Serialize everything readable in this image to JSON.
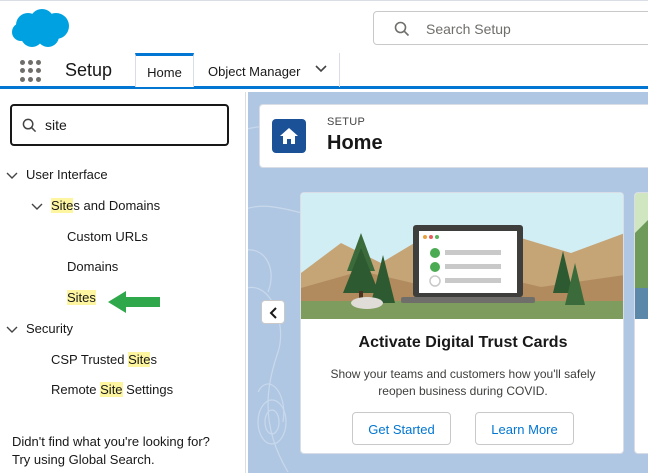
{
  "header": {
    "search_placeholder": "Search Setup"
  },
  "context_bar": {
    "app_name": "Setup",
    "tabs": [
      {
        "label": "Home",
        "active": true
      },
      {
        "label": "Object Manager",
        "active": false
      }
    ]
  },
  "sidebar": {
    "quick_find_value": "site",
    "tree": {
      "user_interface": "User Interface",
      "sites_and_domains_hl": "Site",
      "sites_and_domains_rest": "s and Domains",
      "custom_urls": "Custom URLs",
      "domains": "Domains",
      "sites": "Sites",
      "security": "Security",
      "csp_prefix": "CSP Trusted ",
      "csp_hl": "Site",
      "csp_suffix": "s",
      "remote_prefix": "Remote ",
      "remote_hl": "Site",
      "remote_suffix": " Settings"
    },
    "not_found_line1": "Didn't find what you're looking for?",
    "not_found_line2": "Try using Global Search."
  },
  "page_header": {
    "eyebrow": "SETUP",
    "title": "Home"
  },
  "card": {
    "title": "Activate Digital Trust Cards",
    "description": "Show your teams and customers how you'll safely reopen business during COVID.",
    "primary_button": "Get Started",
    "secondary_button": "Learn More"
  },
  "colors": {
    "brand_blue": "#0176d3",
    "logo_blue": "#00a1e0",
    "highlight": "#fdf5a0",
    "arrow_green": "#2ea84a",
    "home_icon_bg": "#1b5297",
    "main_bg": "#b0c7e3"
  },
  "icons": {
    "logo": "salesforce-cloud-logo",
    "search": "search-icon",
    "launcher": "app-launcher-icon",
    "home": "home-icon",
    "arrow": "green-left-arrow"
  }
}
